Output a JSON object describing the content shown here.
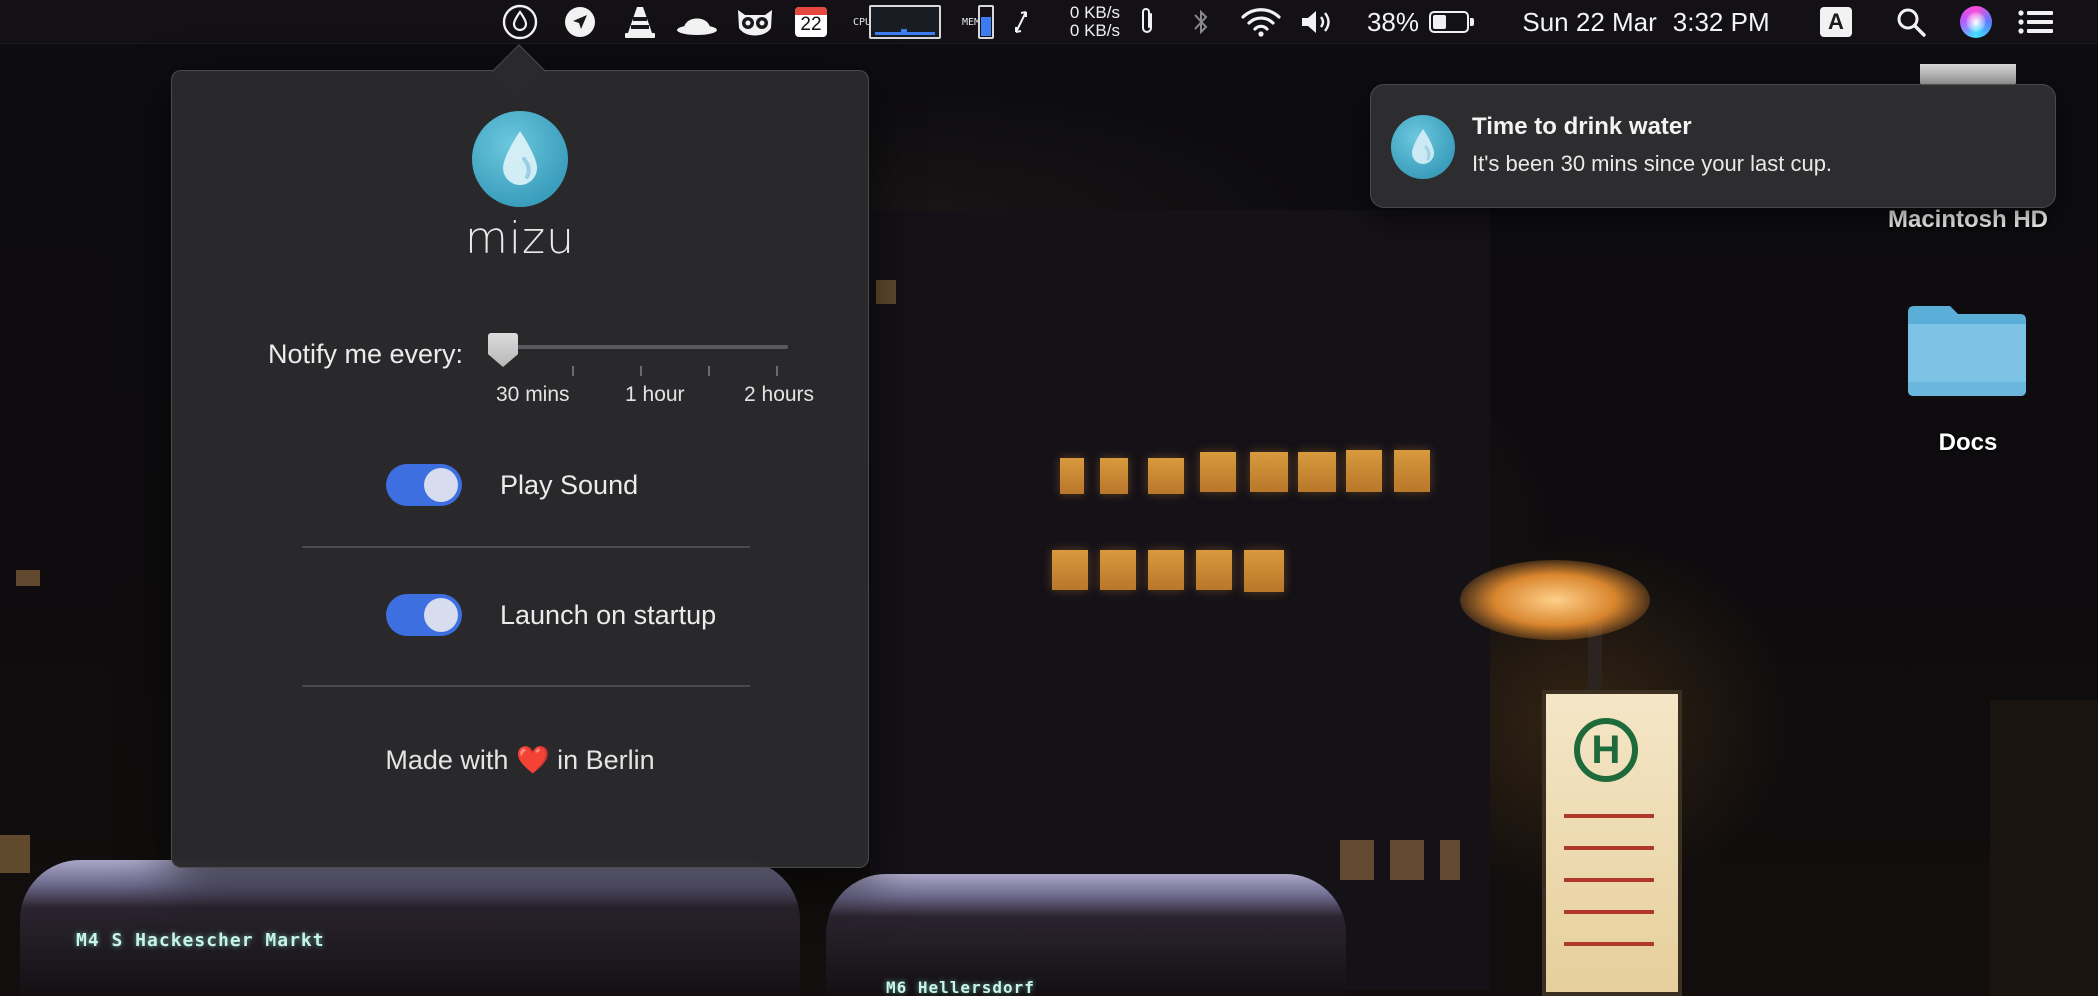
{
  "menubar": {
    "network_up": "0 KB/s",
    "network_down": "0 KB/s",
    "cpu_label": "CPU",
    "mem_label": "MEM",
    "calendar_day": "22",
    "battery_percent": "38%",
    "battery_level": 0.38,
    "date": "Sun 22 Mar",
    "time": "3:32 PM",
    "input_source": "A"
  },
  "popover": {
    "app_name": "mizu",
    "notify_label": "Notify me every:",
    "slider": {
      "labels": [
        "30 mins",
        "1 hour",
        "2 hours"
      ],
      "selected": "30 mins"
    },
    "toggles": [
      {
        "label": "Play Sound",
        "on": true
      },
      {
        "label": "Launch on startup",
        "on": true
      }
    ],
    "footer_prefix": "Made with",
    "footer_heart": "❤️",
    "footer_suffix": "in Berlin"
  },
  "notification": {
    "title": "Time to drink water",
    "body": "It's been 30 mins since your last cup."
  },
  "desktop": {
    "icons": [
      {
        "label": "Macintosh HD",
        "icon": "hard-drive-icon"
      },
      {
        "label": "Docs",
        "icon": "folder-icon"
      }
    ]
  },
  "colors": {
    "accent_toggle": "#3e6fe0",
    "water_blue": "#4aa8c6",
    "menubar_graph": "#3d7cf0"
  }
}
